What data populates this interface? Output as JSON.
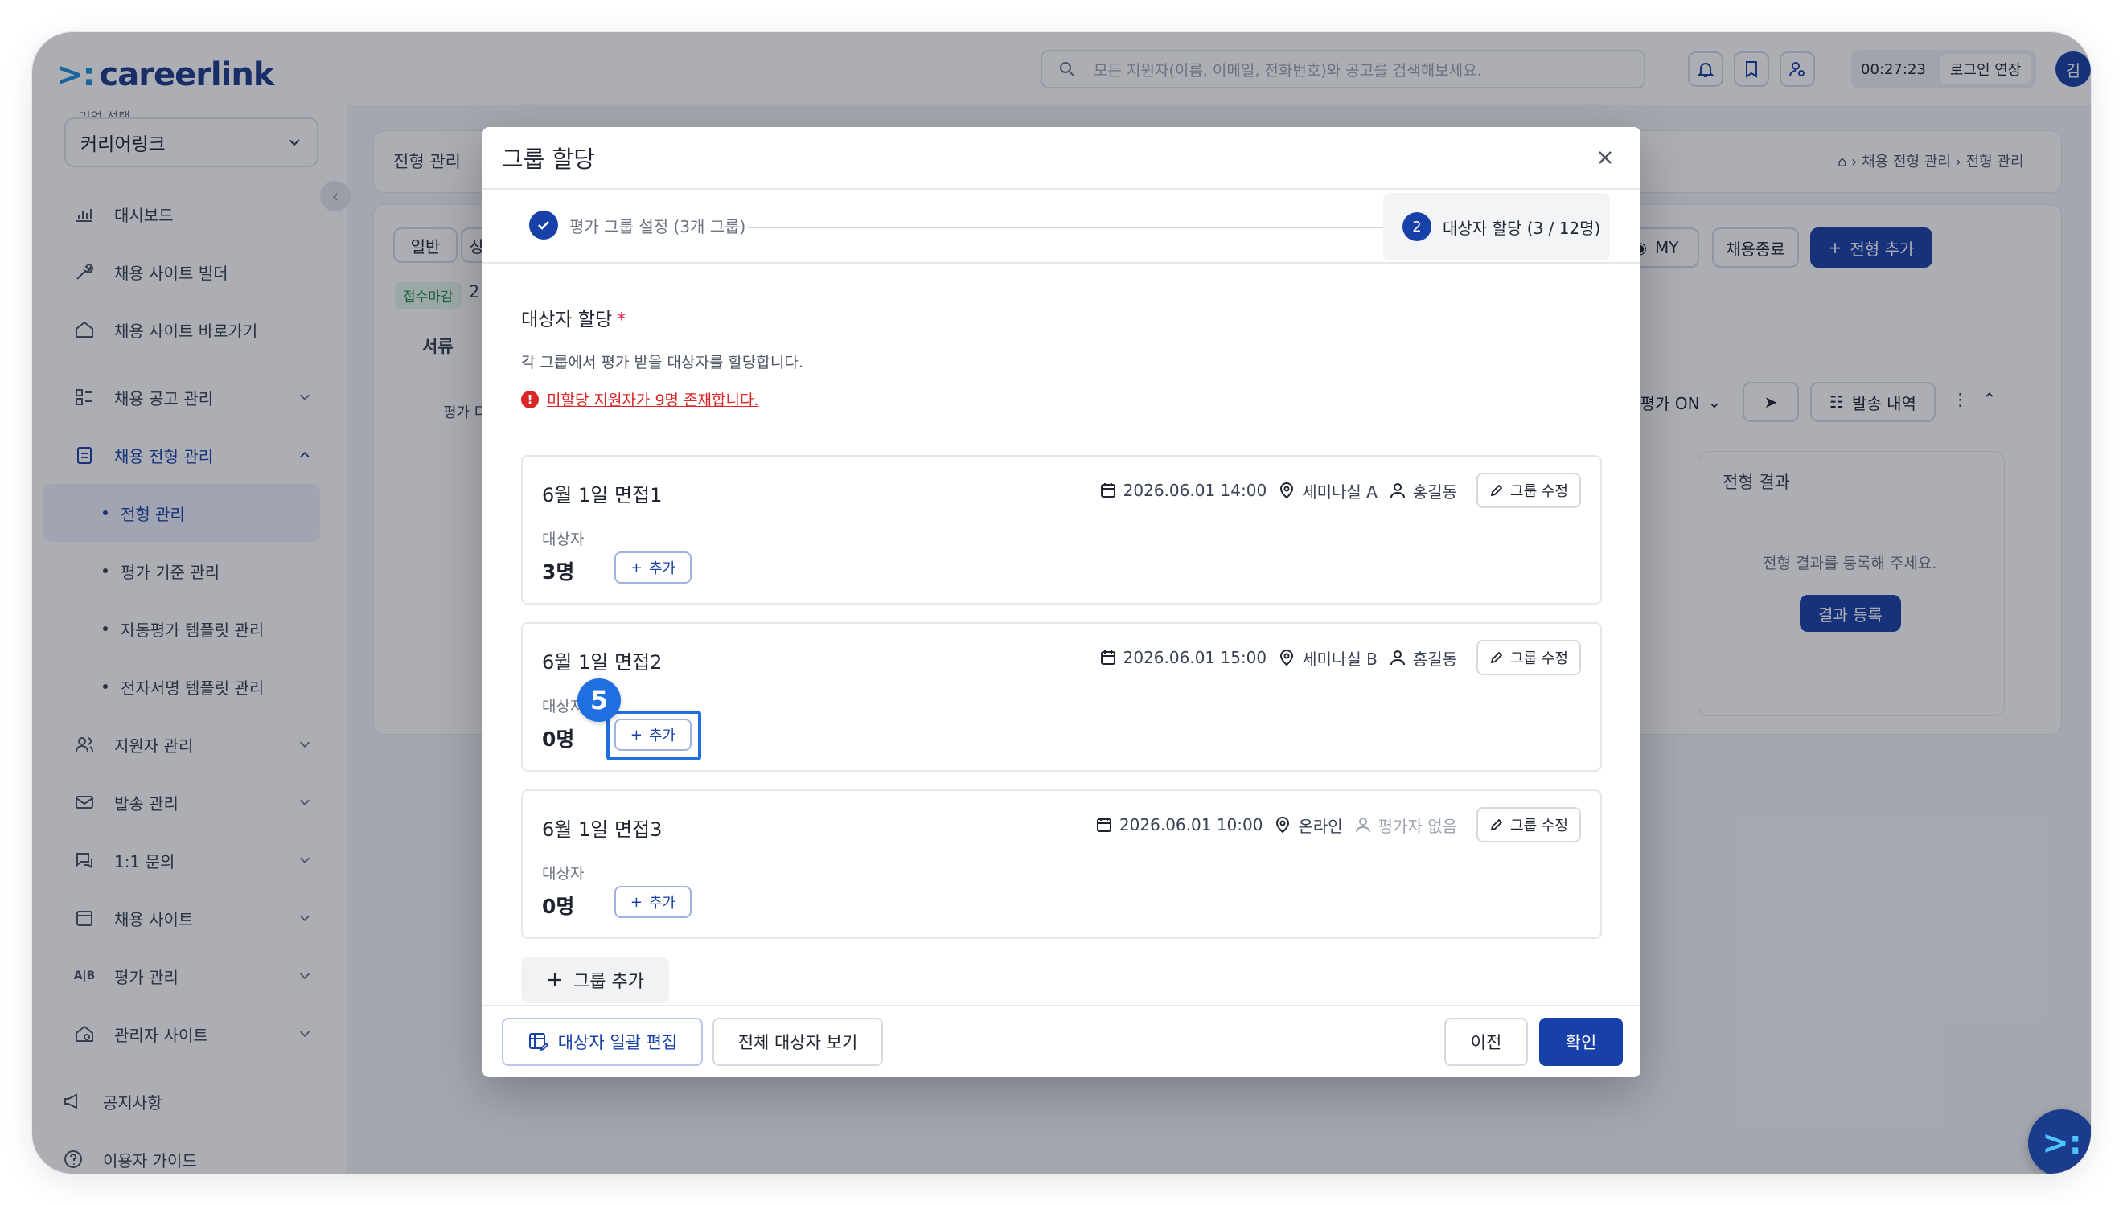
{
  "app": {
    "logo_text": "careerlink",
    "logo_mark": ">:",
    "company_label": "기업 선택",
    "company_value": "커리어링크"
  },
  "sidebar": {
    "items": [
      {
        "label": "대시보드",
        "icon": "dashboard-icon"
      },
      {
        "label": "채용 사이트 빌더",
        "icon": "tools-icon"
      },
      {
        "label": "채용 사이트 바로가기",
        "icon": "home-icon"
      },
      {
        "label": "채용 공고 관리",
        "icon": "list-icon"
      },
      {
        "label": "채용 전형 관리",
        "icon": "clipboard-icon"
      },
      {
        "label": "지원자 관리",
        "icon": "users-icon"
      },
      {
        "label": "발송 관리",
        "icon": "mail-icon"
      },
      {
        "label": "1:1 문의",
        "icon": "chat-icon"
      },
      {
        "label": "채용 사이트",
        "icon": "calendar-icon"
      },
      {
        "label": "평가 관리",
        "icon": "ab-icon"
      },
      {
        "label": "관리자 사이트",
        "icon": "admin-home-icon"
      },
      {
        "label": "공지사항",
        "icon": "megaphone-icon"
      },
      {
        "label": "이용자 가이드",
        "icon": "help-icon"
      }
    ],
    "sub_items": [
      "전형 관리",
      "평가 기준 관리",
      "자동평가 템플릿 관리",
      "전자서명 템플릿 관리"
    ],
    "ab_text": "A|B"
  },
  "topbar": {
    "search_placeholder": "모든 지원자(이름, 이메일, 전화번호)와 공고를 검색해보세요.",
    "timer": "00:27:23",
    "extend_label": "로그인 연장",
    "avatar_initial": "김"
  },
  "background": {
    "page_title": "전형 관리",
    "breadcrumb": [
      "채용 전형 관리",
      "전형 관리"
    ],
    "tab_general": "일반",
    "tab_partial": "상",
    "badge": "접수마감",
    "badge_suffix": "2",
    "my_label": "MY",
    "end_label": "채용종료",
    "add_stage_label": "전형 추가",
    "section_label": "서류",
    "eval_toggle": "평가 ON",
    "send_history": "발송 내역",
    "eval_partial": "평가 다",
    "result_title": "전형 결과",
    "result_desc": "전형 결과를 등록해 주세요.",
    "result_btn": "결과 등록"
  },
  "modal": {
    "title": "그룹 할당",
    "steps": [
      {
        "number": "1",
        "label": "평가 그룹 설정 (3개 그룹)",
        "status": "done"
      },
      {
        "number": "2",
        "label": "대상자 할당 (3 / 12명)",
        "status": "active"
      }
    ],
    "section_title": "대상자 할당",
    "required_mark": "*",
    "section_desc": "각 그룹에서 평가 받을 대상자를 할당합니다.",
    "warning_icon": "!",
    "warning": "미할당 지원자가 9명 존재합니다.",
    "target_label": "대상자",
    "add_label": "추가",
    "edit_label": "그룹 수정",
    "groups": [
      {
        "name": "6월 1일 면접1",
        "datetime": "2026.06.01 14:00",
        "location": "세미나실 A",
        "evaluator": "홍길동",
        "count": "3명"
      },
      {
        "name": "6월 1일 면접2",
        "datetime": "2026.06.01 15:00",
        "location": "세미나실 B",
        "evaluator": "홍길동",
        "count": "0명"
      },
      {
        "name": "6월 1일 면접3",
        "datetime": "2026.06.01 10:00",
        "location": "온라인",
        "evaluator": "평가자 없음",
        "count": "0명"
      }
    ],
    "step_badge": "5",
    "add_group_label": "그룹 추가",
    "footer": {
      "bulk_edit": "대상자 일괄 편집",
      "view_all": "전체 대상자 보기",
      "prev": "이전",
      "confirm": "확인"
    }
  },
  "colors": {
    "primary": "#1741a8",
    "warning": "#dc2626",
    "highlight": "#1f6fe0"
  }
}
